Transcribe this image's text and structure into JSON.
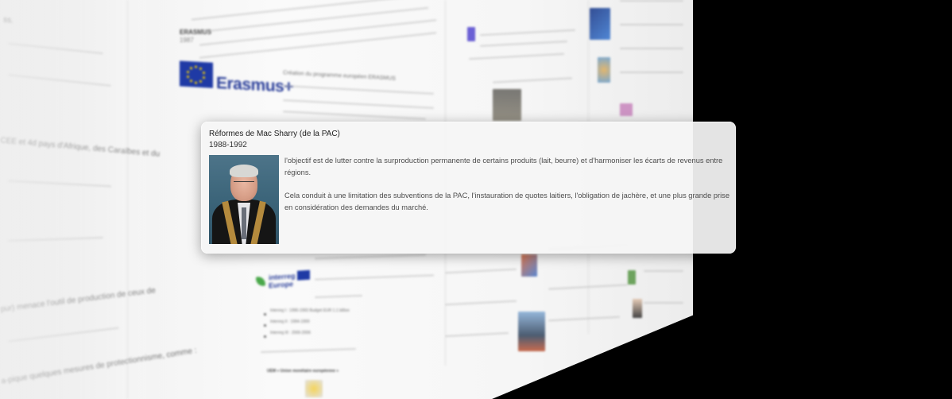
{
  "popup": {
    "title": "Réformes de Mac Sharry (de la PAC)",
    "date": "1988-1992",
    "paragraph_1": "l'objectif est de lutter contre la surproduction permanente de certains produits (lait, beurre) et d'harmoniser les écarts de revenus entre régions.",
    "paragraph_2": "Cela conduit à une limitation des subventions de la PAC, l'instauration de quotes laitiers, l'obligation de jachère, et une plus grande prise en considération des demandes du marché.",
    "portrait_icon": "person-portrait"
  },
  "background": {
    "erasmus_heading": "ERASMUS",
    "erasmus_date": "1987",
    "erasmus_logo_text": "Erasmus+",
    "erasmus_caption": "Création du programme européen ERASMUS",
    "left_snippets": [
      "ss.",
      "CEE et 4d pays d'Afrique, des Caraïbes et du",
      "pur) menace l'outil de production de ceux de",
      "a-pique quelques mesures de protectionnisme, comme :"
    ],
    "interreg_logo_text": "interreg Europe",
    "interreg_items": [
      "Interreg I : 1990-1993 Budget EUR 1.1 billion",
      "Interreg II : 1994-1999",
      "Interreg III : 2000-2006"
    ],
    "uem_heading": "UEM « Union monétaire européenne »"
  },
  "colors": {
    "backdrop": "#000000",
    "popup_background": "#f5f5f5",
    "eu_blue": "#1f3aa5",
    "eu_gold": "#f6d000",
    "erasmus_text": "#2b3f9a"
  }
}
